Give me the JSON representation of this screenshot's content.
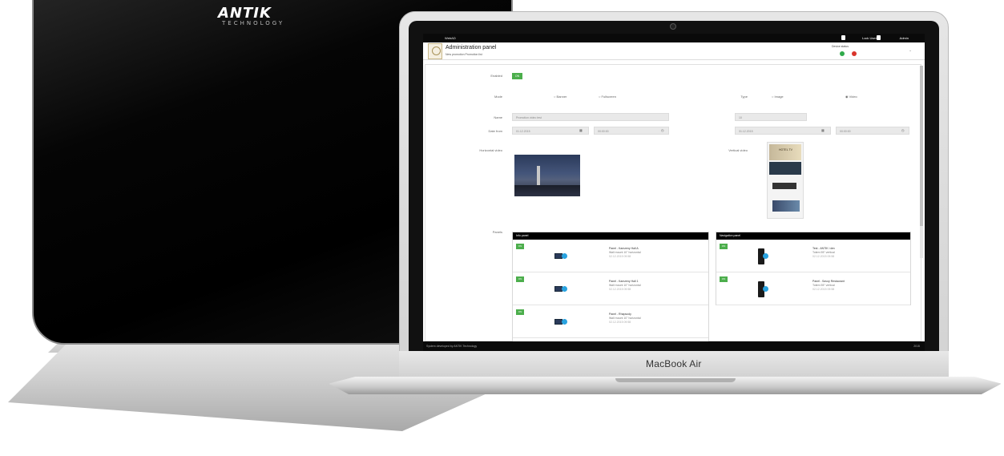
{
  "monitor": {
    "brand": "ANTIK",
    "brand_sub": "TECHNOLOGY"
  },
  "laptop": {
    "brand_label": "MacBook Air"
  },
  "topbar": {
    "app_name": "WebAD",
    "user_label": "Lock User",
    "admin_label": "Admin"
  },
  "header": {
    "title": "Administration panel",
    "sub_links": "New promotion   Promotion list",
    "status_label": "Device status",
    "status_ok": "Online",
    "status_err": "Offline"
  },
  "form": {
    "enabled_label": "Enabled",
    "enabled_value": "ON",
    "mode_label": "Mode",
    "mode_options": [
      "Banner",
      "Fullscreen"
    ],
    "type_label": "Type",
    "type_options": [
      "Image",
      "Video"
    ],
    "name_label": "Name",
    "name_value": "Promotion video test",
    "delay_label": "Delay",
    "delay_value": "10",
    "date_from_label": "Date from",
    "date_from_value": "01.12.2015",
    "time_from_value": "00:00:00",
    "date_to_label": "Date to",
    "date_to_value": "31.12.2015",
    "time_to_value": "00:00:00",
    "horizontal_label": "Horizontal video",
    "vertical_label": "Vertical video",
    "vertical_caption": "HOTEL TV",
    "panels_label": "Panels"
  },
  "info_panel": {
    "title": "Info panel",
    "rows": [
      {
        "toggle": "ON",
        "name": "Panel - Kamzeny Hall A",
        "mount": "Wall mount 10\" horizontal",
        "timestamp": "02.12.2015 09:58"
      },
      {
        "toggle": "ON",
        "name": "Panel - Kamzeny Hall 1",
        "mount": "Wall mount 10\" horizontal",
        "timestamp": "02.12.2015 09:58"
      },
      {
        "toggle": "ON",
        "name": "Panel - Rhapsody",
        "mount": "Wall mount 10\" horizontal",
        "timestamp": "02.12.2015 09:58"
      }
    ]
  },
  "nav_panel": {
    "title": "Navigation panel",
    "rows": [
      {
        "toggle": "ON",
        "name": "Test - ANTIK i dev",
        "mount": "Totem 55\" vertical",
        "timestamp": "02.12.2015 09:58"
      },
      {
        "toggle": "ON",
        "name": "Panel - Savoy Restaurant",
        "mount": "Totem 55\" vertical",
        "timestamp": "02.12.2015 09:58"
      }
    ]
  },
  "footer": {
    "left": "System developed by ANTIK Technology",
    "right": "2015"
  }
}
